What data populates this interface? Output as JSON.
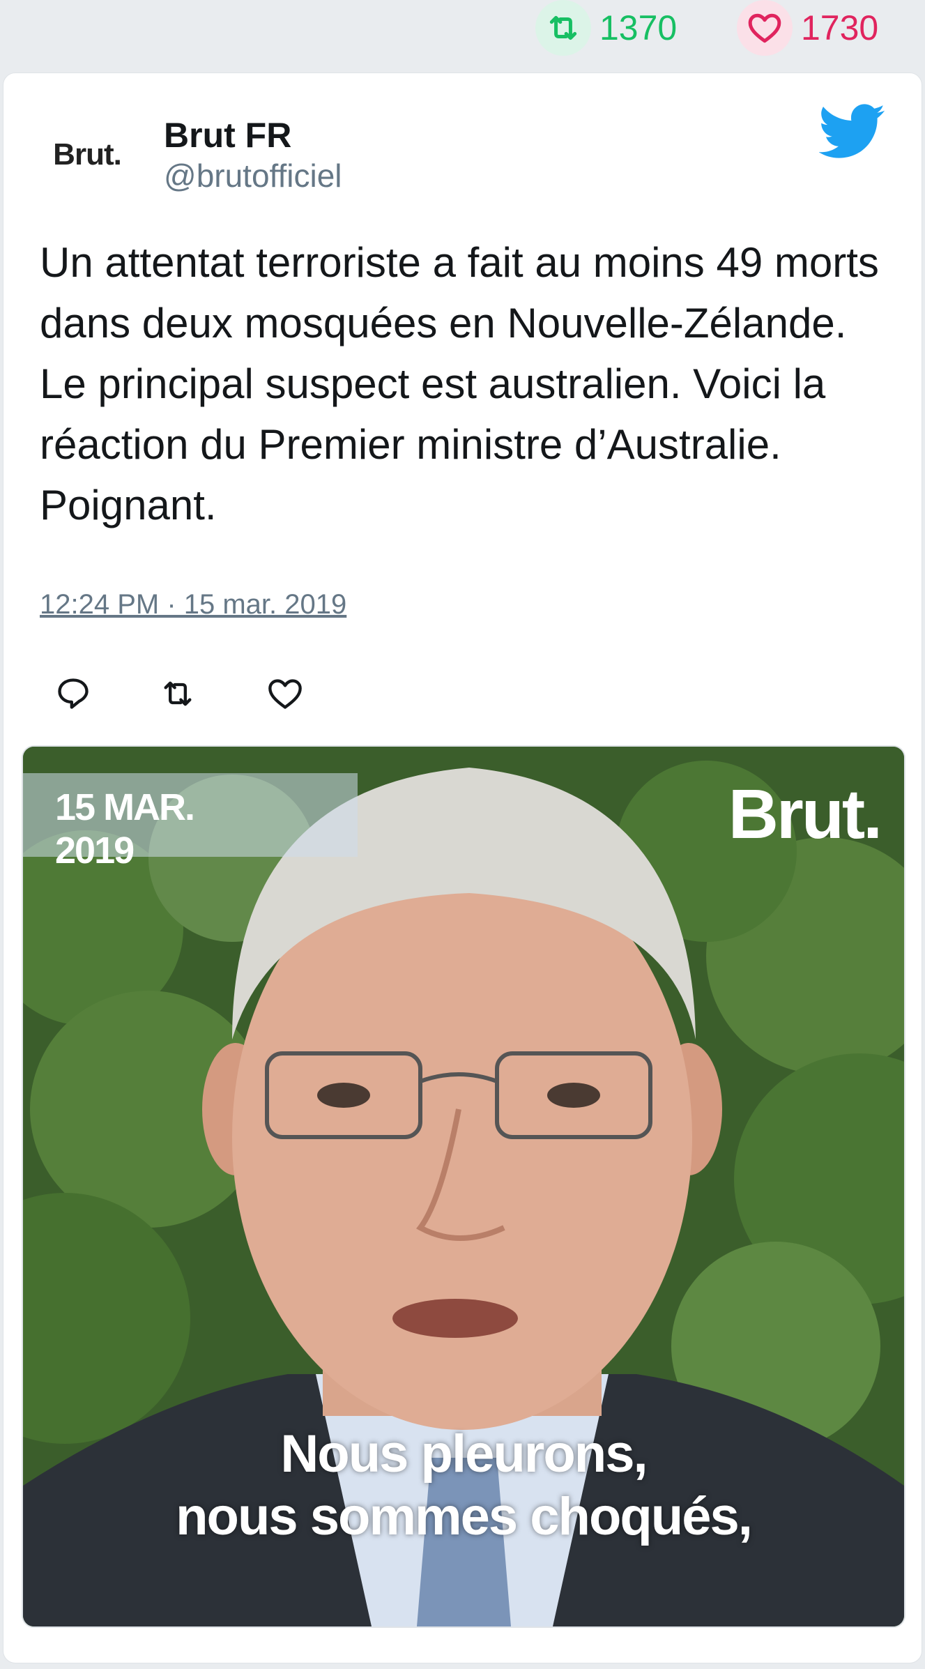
{
  "stats": {
    "retweet_count": "1370",
    "like_count": "1730"
  },
  "tweet": {
    "avatar_text": "Brut.",
    "author_name": "Brut FR",
    "author_handle": "@brutofficiel",
    "text": "Un attentat terroriste a fait au moins 49 morts dans deux mosquées en Nouvelle-Zélande. Le principal suspect est australien. Voici la réaction du Premier ministre d’Australie. Poignant.",
    "timestamp": "12:24 PM · 15 mar. 2019"
  },
  "media": {
    "date_overlay_line1": "15 MAR.",
    "date_overlay_line2": "2019",
    "brand_overlay": "Brut.",
    "subtitle_line1": "Nous pleurons,",
    "subtitle_line2": "nous sommes choqués,"
  },
  "icons": {
    "retweet": "retweet-icon",
    "like": "heart-icon",
    "reply": "reply-icon",
    "brand": "twitter-bird-icon"
  },
  "colors": {
    "retweet_green": "#17bf63",
    "like_red": "#e0245e",
    "twitter_blue": "#1da1f2",
    "secondary_text": "#657786"
  }
}
